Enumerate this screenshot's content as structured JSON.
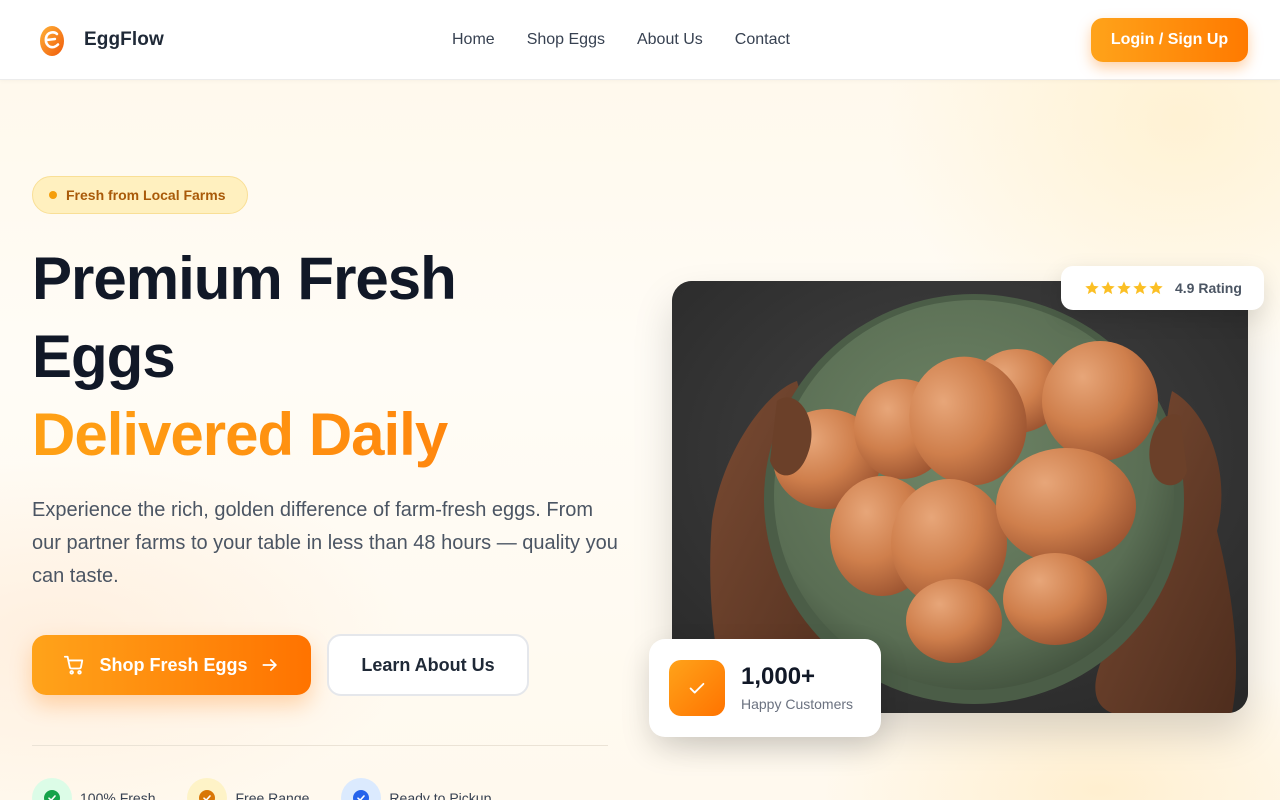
{
  "header": {
    "brand_name": "EggFlow",
    "nav": [
      "Home",
      "Shop Eggs",
      "About Us",
      "Contact"
    ],
    "login_label": "Login / Sign Up"
  },
  "hero": {
    "badge": "Fresh from Local Farms",
    "title_line1": "Premium Fresh",
    "title_line2": "Eggs",
    "title_highlight": "Delivered Daily",
    "description": "Experience the rich, golden difference of farm-fresh eggs. From our partner farms to your table in less than 48 hours — quality you can taste.",
    "primary_cta": "Shop Fresh Eggs",
    "secondary_cta": "Learn About Us"
  },
  "features": [
    {
      "label": "100% Fresh",
      "icon": "check-circle-icon",
      "bg": "#dcfce7",
      "fg": "#16a34a"
    },
    {
      "label": "Free Range",
      "icon": "check-circle-icon",
      "bg": "#fef3c7",
      "fg": "#d97706"
    },
    {
      "label": "Ready to Pickup",
      "icon": "check-circle-icon",
      "bg": "#dbeafe",
      "fg": "#2563eb"
    }
  ],
  "rating": {
    "stars": 5,
    "label": "4.9 Rating"
  },
  "customers": {
    "count": "1,000+",
    "label": "Happy Customers"
  },
  "colors": {
    "accent": "#ff7a00",
    "accent_light": "#ffa31a",
    "star": "#fbbf24"
  }
}
